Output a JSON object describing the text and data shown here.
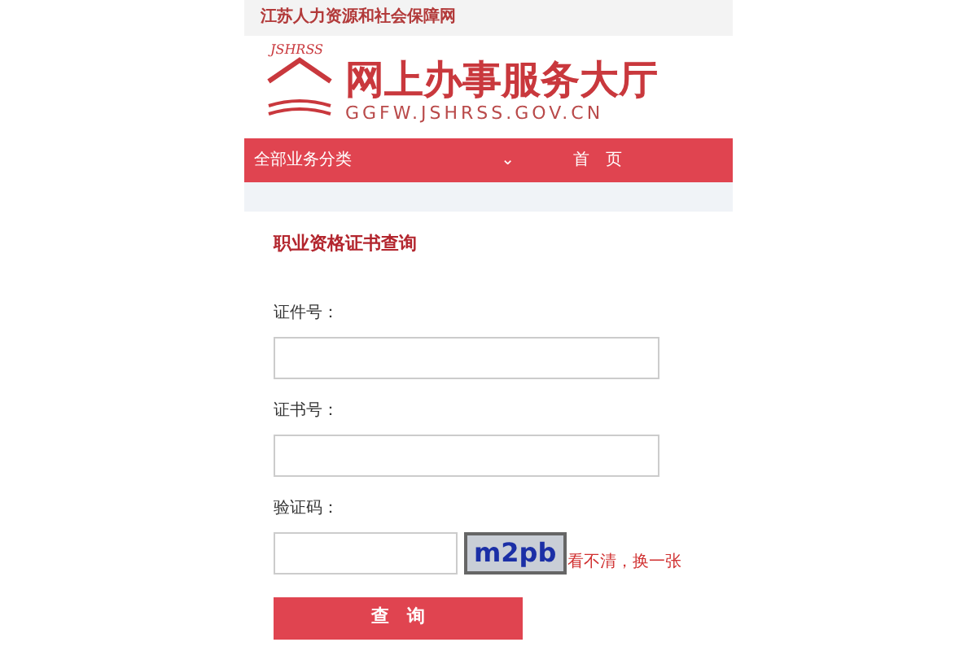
{
  "top_bar": {
    "site_name": "江苏人力资源和社会保障网"
  },
  "header": {
    "logo_text": "JSHRSS",
    "title": "网上办事服务大厅",
    "domain": "GGFW.JSHRSS.GOV.CN"
  },
  "nav": {
    "items": [
      {
        "label": "全部业务分类",
        "kind": "dropdown",
        "caret": "⌄"
      },
      {
        "label": "首　页",
        "kind": "link"
      }
    ]
  },
  "form": {
    "title": "职业资格证书查询",
    "fields": [
      {
        "label": "证件号：",
        "kind": "text"
      },
      {
        "label": "证书号：",
        "kind": "text"
      },
      {
        "label": "验证码：",
        "kind": "captcha",
        "captcha": "m2pb",
        "refresh": "看不清，换一张"
      }
    ],
    "submit": "查　询"
  }
}
